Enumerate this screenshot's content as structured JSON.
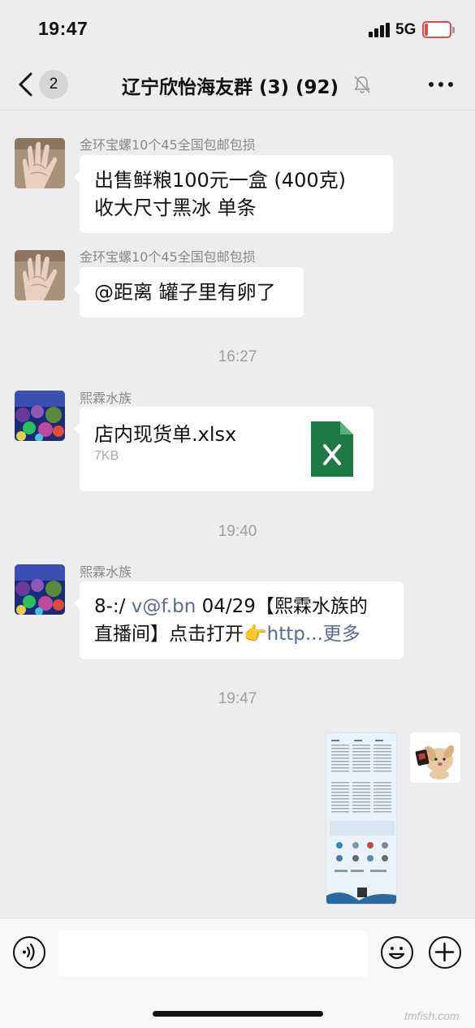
{
  "status_bar": {
    "time": "19:47",
    "network": "5G",
    "battery_level": "14",
    "battery_fraction": 0.14,
    "battery_color": "#e04c4c"
  },
  "nav": {
    "back_icon": "chevron-left-icon",
    "unread_count": "2",
    "title": "辽宁欣怡海友群 (3) (92)",
    "mute_icon": "bell-slash-icon",
    "more_icon": "ellipsis-icon"
  },
  "messages": [
    {
      "sender": "金环宝螺10个45全国包邮包损",
      "text_lines": [
        "出售鲜粮100元一盒 (400克)",
        "收大尺寸黑冰 单条"
      ]
    },
    {
      "sender": "金环宝螺10个45全国包邮包损",
      "text_lines": [
        "@距离 罐子里有卵了"
      ]
    },
    {
      "time": "16:27",
      "sender": "熙霖水族",
      "file_name": "店内现货单.xlsx",
      "file_size": "7KB",
      "file_icon": "excel-file-icon"
    },
    {
      "time": "19:40",
      "sender": "熙霖水族",
      "line1_prefix": "8-:/ ",
      "line1_link": "v@f.bn",
      "line1_suffix": " 04/29【熙霖水族的",
      "line2_prefix": "直播间】点击打开👉",
      "line2_link": "http...",
      "line2_more": "更多"
    },
    {
      "time": "19:47",
      "type": "image",
      "image_desc_icon": "price-list-image"
    }
  ],
  "input_bar": {
    "voice_icon": "voice-icon",
    "emoji_icon": "emoji-icon",
    "plus_icon": "plus-icon",
    "input_value": ""
  },
  "watermark": "tmfish.com"
}
